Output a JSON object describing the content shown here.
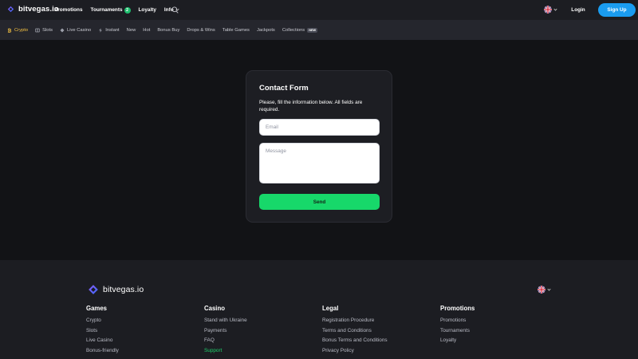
{
  "header": {
    "brand": "bitvegas.io",
    "nav": [
      {
        "label": "Promotions"
      },
      {
        "label": "Tournaments",
        "badge": "2"
      },
      {
        "label": "Loyalty"
      },
      {
        "label": "Info"
      }
    ],
    "login_label": "Login",
    "signup_label": "Sign Up",
    "language_flag": "uk-flag-icon"
  },
  "categories": [
    {
      "label": "Crypto",
      "icon": "bitcoin-icon",
      "active": true
    },
    {
      "label": "Slots",
      "icon": "slots-icon"
    },
    {
      "label": "Live Casino",
      "icon": "live-casino-icon"
    },
    {
      "label": "Instant",
      "icon": "lightning-icon"
    },
    {
      "label": "New"
    },
    {
      "label": "Hot"
    },
    {
      "label": "Bonus Buy"
    },
    {
      "label": "Drops & Wins"
    },
    {
      "label": "Table Games"
    },
    {
      "label": "Jackpots"
    },
    {
      "label": "Collections",
      "tag": "NEW"
    }
  ],
  "contact_form": {
    "title": "Contact Form",
    "description": "Please, fill the information below. All fields are required.",
    "email_placeholder": "Email",
    "message_placeholder": "Message",
    "send_label": "Send"
  },
  "footer": {
    "brand": "bitvegas.io",
    "columns": [
      {
        "title": "Games",
        "links": [
          "Crypto",
          "Slots",
          "Live Casino",
          "Bonus-friendly"
        ]
      },
      {
        "title": "Casino",
        "links": [
          "Stand with Ukraine",
          "Payments",
          "FAQ",
          "Support"
        ]
      },
      {
        "title": "Legal",
        "links": [
          "Registration Procedure",
          "Terms and Conditions",
          "Bonus Terms and Conditions",
          "Privacy Policy"
        ]
      },
      {
        "title": "Promotions",
        "links": [
          "Promotions",
          "Tournaments",
          "Loyalty"
        ]
      }
    ]
  },
  "colors": {
    "accent_blue": "#1a9cf0",
    "accent_green": "#17d86a",
    "active_category": "#f5c242",
    "background": "#121316"
  }
}
